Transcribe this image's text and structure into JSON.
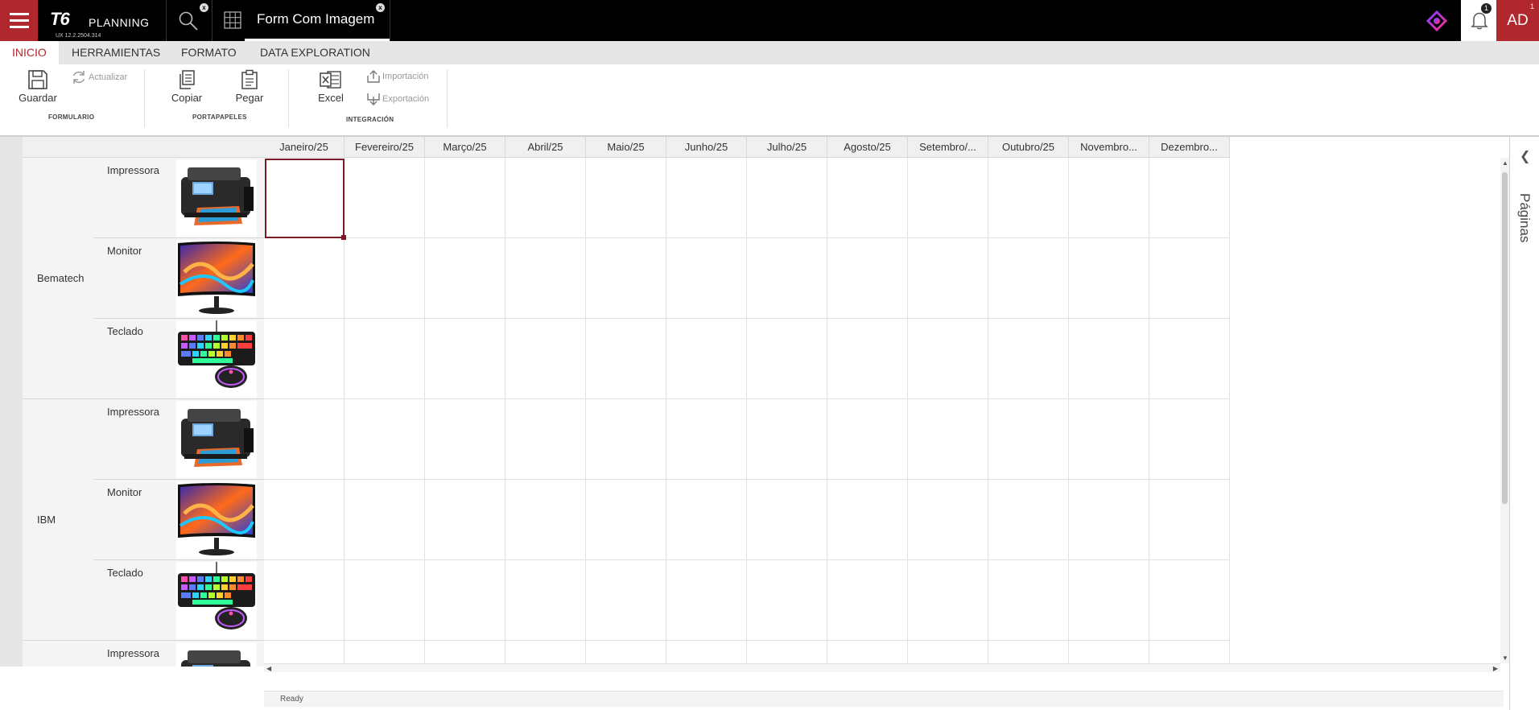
{
  "app": {
    "logo_text": "PLANNING",
    "logo_mark": "T6",
    "version": "UX 12.2.2504.314",
    "tab_title": "Form Com Imagem",
    "tab_close": "x",
    "search_close": "x",
    "notification_count": "1",
    "avatar_badge": "1",
    "avatar_initials": "AD"
  },
  "ribbon": {
    "tabs": [
      "INICIO",
      "HERRAMIENTAS",
      "FORMATO",
      "DATA EXPLORATION"
    ],
    "active_tab": "INICIO",
    "guardar": "Guardar",
    "actualizar": "Actualizar",
    "group_formulario": "FORMULARIO",
    "copiar": "Copiar",
    "pegar": "Pegar",
    "group_portapapeles": "PORTAPAPELES",
    "excel": "Excel",
    "importacion": "Importación",
    "exportacion": "Exportación",
    "group_integracion": "INTEGRACIÓN"
  },
  "grid": {
    "columns": [
      "Janeiro/25",
      "Fevereiro/25",
      "Março/25",
      "Abril/25",
      "Maio/25",
      "Junho/25",
      "Julho/25",
      "Agosto/25",
      "Setembro/...",
      "Outubro/25",
      "Novembro...",
      "Dezembro..."
    ],
    "brands": [
      "Bematech",
      "IBM"
    ],
    "rows": [
      {
        "brand": "Bematech",
        "product": "Impressora",
        "image": "printer-image"
      },
      {
        "brand": "Bematech",
        "product": "Monitor",
        "image": "monitor-image"
      },
      {
        "brand": "Bematech",
        "product": "Teclado",
        "image": "keyboard-image"
      },
      {
        "brand": "IBM",
        "product": "Impressora",
        "image": "printer-image"
      },
      {
        "brand": "IBM",
        "product": "Monitor",
        "image": "monitor-image"
      },
      {
        "brand": "IBM",
        "product": "Teclado",
        "image": "keyboard-image"
      },
      {
        "brand": "",
        "product": "Impressora",
        "image": "printer-image"
      }
    ]
  },
  "status": "Ready",
  "right_panel": {
    "label": "Páginas"
  },
  "colors": {
    "accent": "#b0272e",
    "selection": "#7a1a25",
    "topbar": "#000000"
  }
}
